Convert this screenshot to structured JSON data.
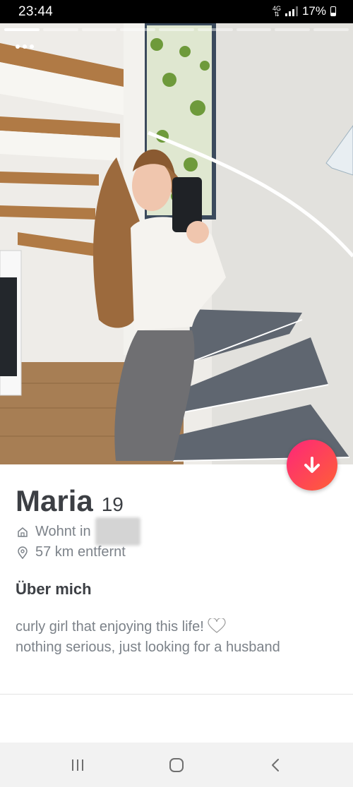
{
  "status": {
    "time": "23:44",
    "network": "4G",
    "battery": "17%"
  },
  "profile": {
    "name": "Maria",
    "age": "19",
    "lives_in_label": "Wohnt in",
    "distance": "57 km entfernt",
    "about_title": "Über mich",
    "bio_line1": "curly girl that enjoying this life!",
    "bio_line2": "nothing serious, just looking for a husband"
  },
  "colors": {
    "accent_gradient_start": "#fd267a",
    "accent_gradient_end": "#ff6036",
    "text_dark": "#3c3f44",
    "text_muted": "#7c8289"
  },
  "icons": [
    "more-dots-icon",
    "arrow-down-icon",
    "home-icon",
    "location-pin-icon",
    "heart-icon",
    "recents-icon",
    "home-nav-icon",
    "back-icon"
  ]
}
